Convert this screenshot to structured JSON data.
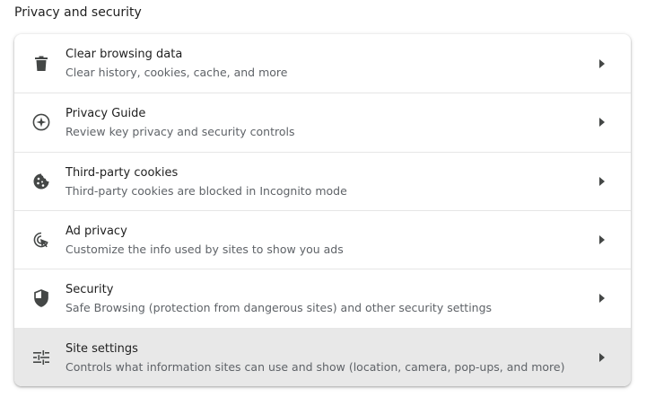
{
  "section": {
    "title": "Privacy and security"
  },
  "rows": [
    {
      "title": "Clear browsing data",
      "subtitle": "Clear history, cookies, cache, and more",
      "icon": "trash-icon"
    },
    {
      "title": "Privacy Guide",
      "subtitle": "Review key privacy and security controls",
      "icon": "compass-icon"
    },
    {
      "title": "Third-party cookies",
      "subtitle": "Third-party cookies are blocked in Incognito mode",
      "icon": "cookie-icon"
    },
    {
      "title": "Ad privacy",
      "subtitle": "Customize the info used by sites to show you ads",
      "icon": "ad-privacy-icon"
    },
    {
      "title": "Security",
      "subtitle": "Safe Browsing (protection from dangerous sites) and other security settings",
      "icon": "shield-icon"
    },
    {
      "title": "Site settings",
      "subtitle": "Controls what information sites can use and show (location, camera, pop-ups, and more)",
      "icon": "tune-icon",
      "highlighted": true
    }
  ],
  "colors": {
    "text_primary": "#1f1f1f",
    "text_secondary": "#5f6368",
    "icon": "#444746",
    "hover_background": "#e8e8e8",
    "divider": "#e6e6e6"
  }
}
